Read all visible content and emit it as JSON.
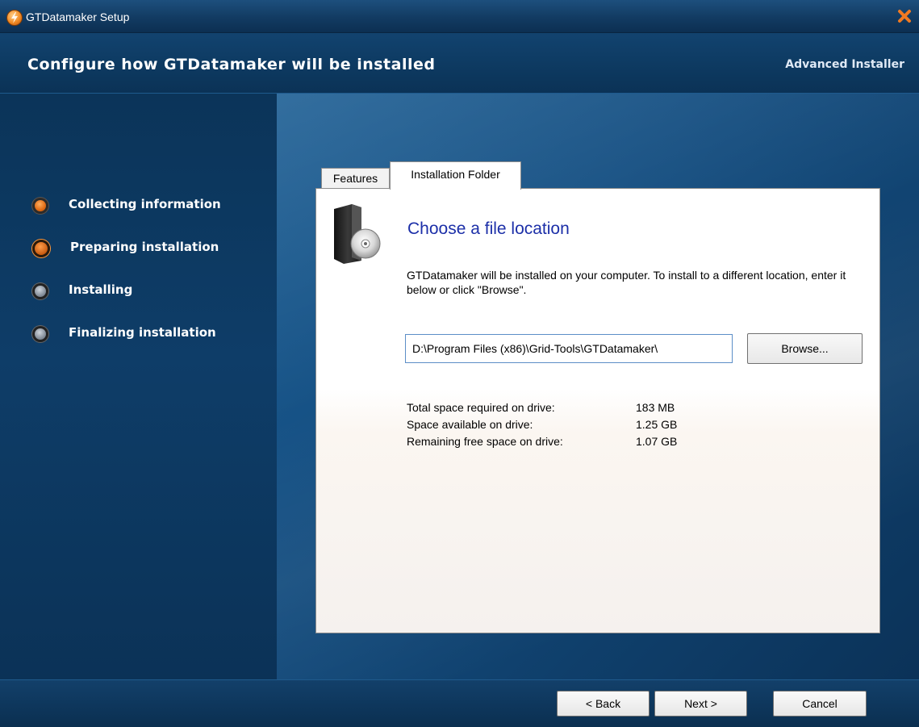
{
  "window": {
    "title": "GTDatamaker Setup"
  },
  "header": {
    "title": "Configure how GTDatamaker will be installed",
    "brand": "Advanced Installer"
  },
  "steps": [
    {
      "label": "Collecting information",
      "state": "done"
    },
    {
      "label": "Preparing installation",
      "state": "active"
    },
    {
      "label": "Installing",
      "state": "pending"
    },
    {
      "label": "Finalizing installation",
      "state": "pending"
    }
  ],
  "tabs": [
    {
      "label": "Features"
    },
    {
      "label": "Installation Folder"
    }
  ],
  "folder": {
    "heading": "Choose a file location",
    "description": "GTDatamaker will be installed on your computer. To install to a different location, enter it below or click \"Browse\".",
    "path": "D:\\Program Files (x86)\\Grid-Tools\\GTDatamaker\\",
    "browse_label": "Browse...",
    "space": [
      {
        "label": "Total space required on drive:",
        "value": "183 MB"
      },
      {
        "label": "Space available on drive:",
        "value": "1.25 GB"
      },
      {
        "label": "Remaining free space on drive:",
        "value": "1.07 GB"
      }
    ]
  },
  "footer": {
    "back_label": "< Back",
    "next_label": "Next >",
    "cancel_label": "Cancel"
  },
  "colors": {
    "heading_blue": "#1c2fa8",
    "accent_orange": "#e06a14"
  }
}
